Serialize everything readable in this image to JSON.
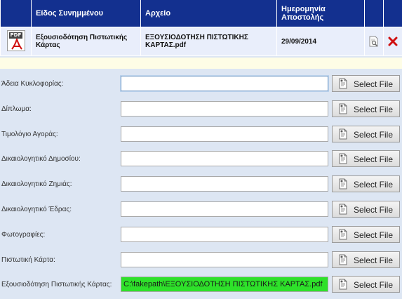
{
  "table": {
    "headers": [
      "",
      "Είδος Συνημμένου",
      "Αρχείο",
      "Ημερομηνία Αποστολής",
      "",
      ""
    ],
    "rows": [
      {
        "type": "Εξουσιοδότηση Πιστωτικής Κάρτας",
        "file": "ΕΞΟΥΣΙΟΔΟΤΗΣΗ ΠΙΣΤΩΤΙΚΗΣ ΚΑΡΤΑΣ.pdf",
        "date": "29/09/2014",
        "file_icon": "pdf-icon",
        "view_icon": "view-document-icon",
        "delete_icon": "delete-icon",
        "pdf_tag": "PDF"
      }
    ]
  },
  "form": {
    "button_label": "Select File",
    "fields": [
      {
        "label": "Άδεια Κυκλοφορίας:",
        "value": "",
        "focused": true
      },
      {
        "label": "Δίπλωμα:",
        "value": ""
      },
      {
        "label": "Τιμολόγιο Αγοράς:",
        "value": ""
      },
      {
        "label": "Δικαιολογητικό Δημοσίου:",
        "value": ""
      },
      {
        "label": "Δικαιολογητικό Ζημιάς:",
        "value": ""
      },
      {
        "label": "Δικαιολογητικό Έδρας:",
        "value": ""
      },
      {
        "label": "Φωτογραφίες:",
        "value": ""
      },
      {
        "label": "Πιστωτική Κάρτα:",
        "value": ""
      },
      {
        "label": "Εξουσιοδότηση Πιστωτικής Κάρτας:",
        "value": "C:\\fakepath\\ΕΞΟΥΣΙΟΔΟΤΗΣΗ ΠΙΣΤΩΤΙΚΗΣ ΚΑΡΤΑΣ.pdf",
        "filled": true
      }
    ]
  },
  "colors": {
    "header_bg": "#13308f",
    "row_bg": "#e9eefb",
    "page_bg": "#dde6f3",
    "filled_input": "#2ee12a",
    "delete_red": "#d01010"
  }
}
